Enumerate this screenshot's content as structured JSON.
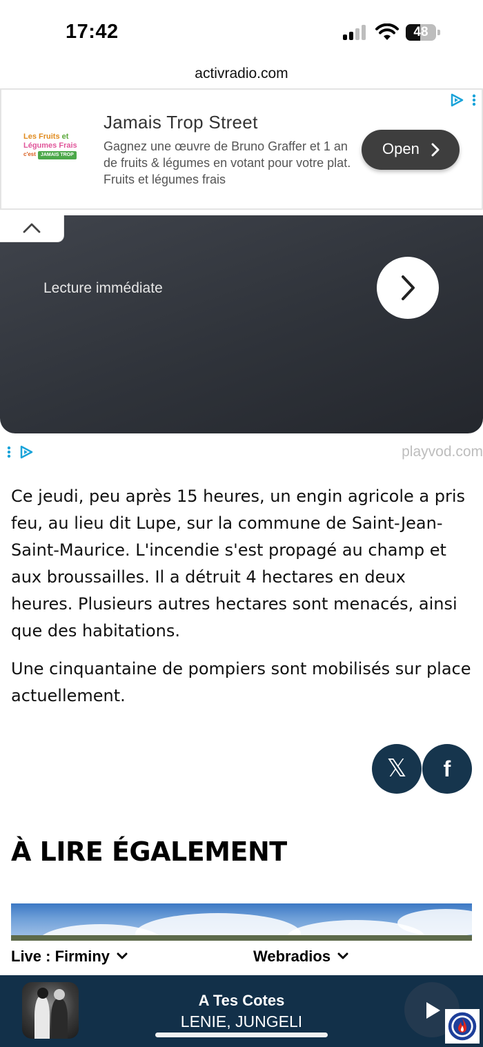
{
  "status_bar": {
    "time": "17:42",
    "battery": "48",
    "battery_level": 0.48
  },
  "browser": {
    "url": "activradio.com"
  },
  "ad": {
    "logo_line1_a": "Les Fruits",
    "logo_line1_b": "et",
    "logo_line2": "Légumes Frais",
    "logo_line3": "c'est",
    "logo_tag": "JAMAIS TROP",
    "title": "Jamais Trop Street",
    "description": "Gagnez une œuvre de Bruno Graffer et 1 an de fruits & légumes en votant pour votre plat. Fruits et légumes frais",
    "cta": "Open"
  },
  "video_player": {
    "label": "Lecture immédiate",
    "source": "playvod.com"
  },
  "article": {
    "paragraphs": [
      "Ce jeudi, peu après 15 heures, un engin agricole a pris feu, au lieu dit Lupe, sur la commune de Saint-Jean-Saint-Maurice. L'incendie s'est propagé au champ et aux broussailles. Il a détruit 4 hectares en deux heures. Plusieurs autres hectares sont menacés, ainsi que des habitations.",
      "Une cinquantaine de pompiers sont mobilisés sur place actuellement."
    ]
  },
  "share": {
    "x_glyph": "𝕏",
    "facebook_glyph": "f"
  },
  "related": {
    "title": "À LIRE ÉGALEMENT"
  },
  "radio": {
    "live_label": "Live : Firminy",
    "webradios_label": "Webradios",
    "track_title": "A Tes Cotes",
    "track_artist": "LENIE, JUNGELI"
  },
  "icons": {
    "ad_choices": "adchoices-icon",
    "collapse": "chevron-up-icon",
    "next": "chevron-right-icon",
    "play": "play-icon",
    "dropdown": "chevron-down-icon"
  },
  "colors": {
    "player_bar": "#123049",
    "share_button": "#16354d",
    "ad_cta": "#3e3e3e",
    "ad_choices": "#1aa3d9"
  }
}
